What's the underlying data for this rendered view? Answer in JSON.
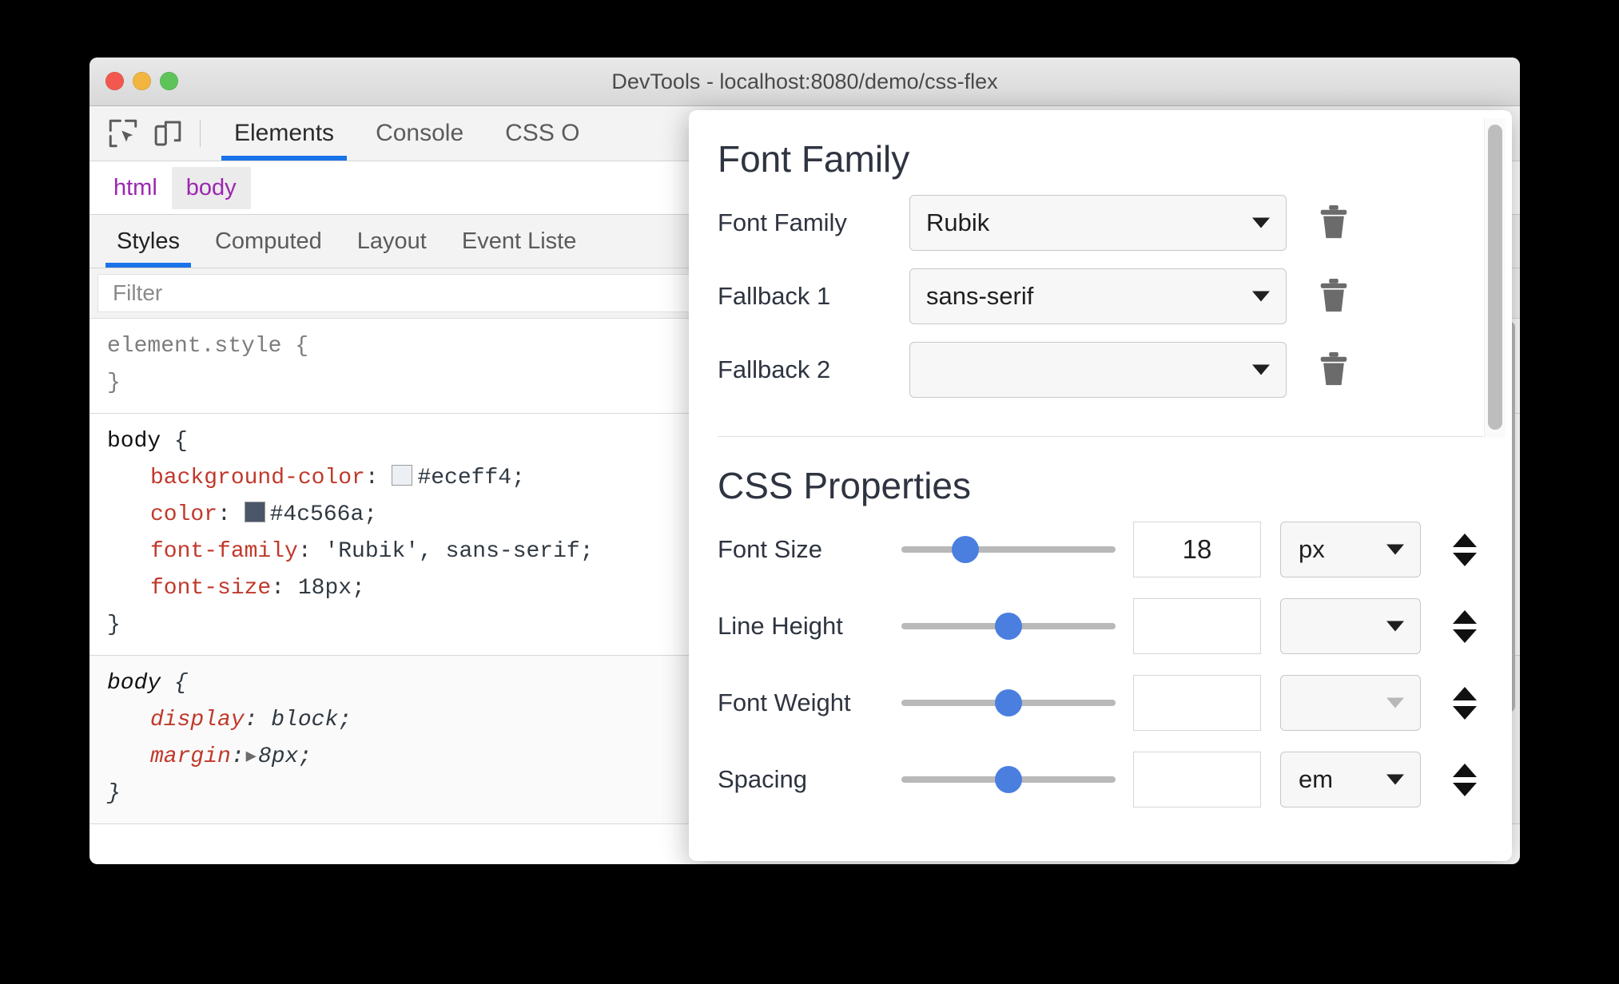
{
  "window": {
    "title": "DevTools - localhost:8080/demo/css-flex",
    "traffic_lights": [
      "close",
      "minimize",
      "zoom"
    ]
  },
  "toolbar": {
    "inspect_icon": "inspect-element-icon",
    "device_icon": "device-toolbar-icon",
    "tabs": [
      {
        "label": "Elements",
        "active": true
      },
      {
        "label": "Console",
        "active": false
      },
      {
        "label": "CSS O",
        "active": false
      }
    ]
  },
  "breadcrumb": {
    "items": [
      {
        "label": "html",
        "selected": false
      },
      {
        "label": "body",
        "selected": true
      }
    ]
  },
  "sidebar_tabs": [
    {
      "label": "Styles",
      "active": true
    },
    {
      "label": "Computed",
      "active": false
    },
    {
      "label": "Layout",
      "active": false
    },
    {
      "label": "Event Liste",
      "active": false
    }
  ],
  "filter": {
    "value": "",
    "placeholder": "Filter"
  },
  "css_rules": [
    {
      "selector": "element.style",
      "open_brace": "{",
      "close_brace": "}",
      "style": "greyed",
      "declarations": []
    },
    {
      "selector": "body",
      "open_brace": "{",
      "close_brace": "}",
      "style": "author",
      "declarations": [
        {
          "property": "background-color",
          "value": "#eceff4",
          "swatch": "#eceff4",
          "terminator": ";"
        },
        {
          "property": "color",
          "value": "#4c566a",
          "swatch": "#4c566a",
          "terminator": ";"
        },
        {
          "property": "font-family",
          "value": "'Rubik', sans-serif",
          "terminator": ";"
        },
        {
          "property": "font-size",
          "value": "18px",
          "terminator": ";"
        }
      ]
    },
    {
      "selector": "body",
      "open_brace": "{",
      "close_brace": "}",
      "style": "user-agent",
      "declarations": [
        {
          "property": "display",
          "value": "block",
          "terminator": ";"
        },
        {
          "property": "margin",
          "value": "8px",
          "expandable": true,
          "terminator": ";"
        }
      ]
    }
  ],
  "popup": {
    "font_family_section": {
      "title": "Font Family",
      "rows": [
        {
          "label": "Font Family",
          "value": "Rubik",
          "delete_icon": "trash-icon"
        },
        {
          "label": "Fallback 1",
          "value": "sans-serif",
          "delete_icon": "trash-icon"
        },
        {
          "label": "Fallback 2",
          "value": "",
          "delete_icon": "trash-icon"
        }
      ]
    },
    "css_properties_section": {
      "title": "CSS Properties",
      "rows": [
        {
          "label": "Font Size",
          "slider_percent": 30,
          "value": "18",
          "unit": "px",
          "unit_enabled": true
        },
        {
          "label": "Line Height",
          "slider_percent": 50,
          "value": "",
          "unit": "",
          "unit_enabled": true
        },
        {
          "label": "Font Weight",
          "slider_percent": 50,
          "value": "",
          "unit": "",
          "unit_enabled": false
        },
        {
          "label": "Spacing",
          "slider_percent": 50,
          "value": "",
          "unit": "em",
          "unit_enabled": true
        }
      ]
    }
  },
  "colors": {
    "accent_blue": "#1a73e8",
    "slider_blue": "#4a7fe0",
    "crumb_purple": "#9c27b0",
    "css_property_red": "#c0392b",
    "record_red": "#d93025"
  }
}
